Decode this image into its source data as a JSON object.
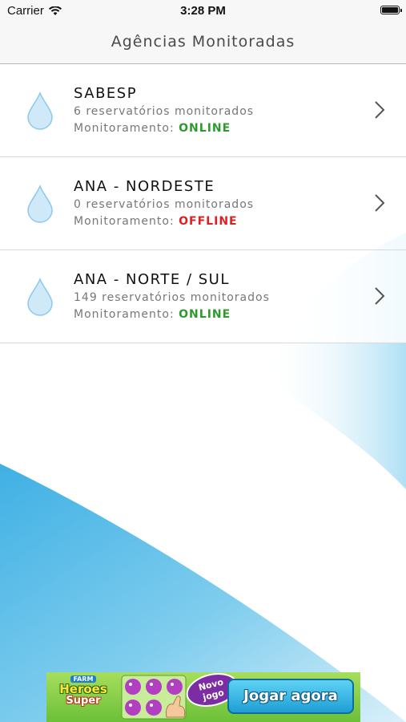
{
  "status_bar": {
    "carrier": "Carrier",
    "time": "3:28 PM",
    "wifi_icon": "wifi-icon",
    "battery_icon": "battery-icon"
  },
  "nav": {
    "title": "Agências Monitoradas"
  },
  "agencies": [
    {
      "name": "SABESP",
      "subtitle": "6 reservatórios monitorados",
      "status_label": "Monitoramento:",
      "status": "ONLINE",
      "icon": "water-drop-icon"
    },
    {
      "name": "ANA - NORDESTE",
      "subtitle": "0 reservatórios monitorados",
      "status_label": "Monitoramento:",
      "status": "OFFLINE",
      "icon": "water-drop-icon"
    },
    {
      "name": "ANA - NORTE / SUL",
      "subtitle": "149 reservatórios monitorados",
      "status_label": "Monitoramento:",
      "status": "ONLINE",
      "icon": "water-drop-icon"
    }
  ],
  "ad": {
    "logo_farm": "FARM",
    "logo_heroes": "Heroes",
    "logo_super": "Super",
    "badge_line1": "Novo",
    "badge_line2": "jogo",
    "cta": "Jogar agora"
  },
  "colors": {
    "online": "#2e9a2e",
    "offline": "#e02020",
    "accent_blue": "#5cc1ea",
    "nav_bg": "#f7f7f7"
  }
}
